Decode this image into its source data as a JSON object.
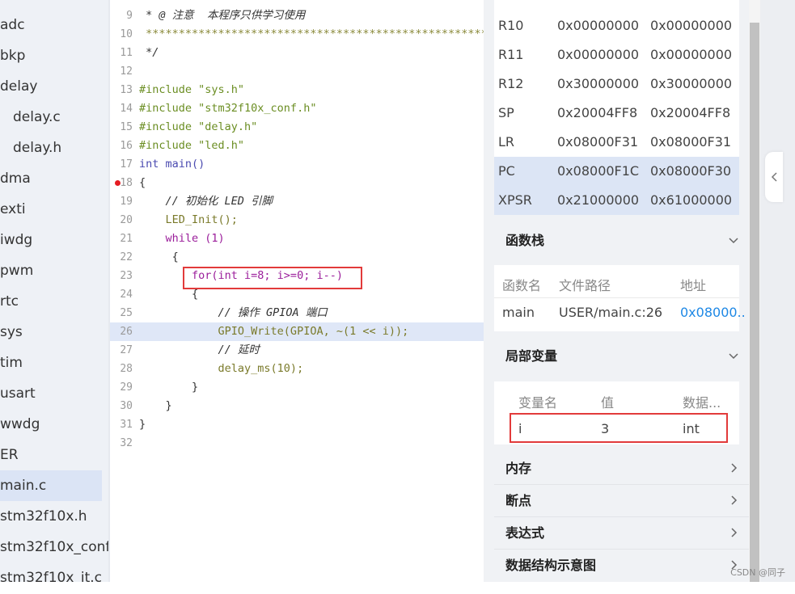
{
  "file_tree": [
    {
      "label": "adc"
    },
    {
      "label": "bkp"
    },
    {
      "label": "delay"
    },
    {
      "label": "delay.c"
    },
    {
      "label": "delay.h"
    },
    {
      "label": "dma"
    },
    {
      "label": "exti"
    },
    {
      "label": "iwdg"
    },
    {
      "label": "pwm"
    },
    {
      "label": "rtc"
    },
    {
      "label": "sys"
    },
    {
      "label": "tim"
    },
    {
      "label": "usart"
    },
    {
      "label": "wwdg"
    },
    {
      "label": "ER"
    },
    {
      "label": "main.c"
    },
    {
      "label": "stm32f10x.h"
    },
    {
      "label": "stm32f10x_conf.h"
    },
    {
      "label": "stm32f10x_it.c"
    }
  ],
  "editor": {
    "line_numbers": [
      "9",
      "10",
      "11",
      "12",
      "13",
      "14",
      "15",
      "16",
      "17",
      "18",
      "19",
      "20",
      "21",
      "22",
      "23",
      "24",
      "25",
      "26",
      "27",
      "28",
      "29",
      "30",
      "31",
      "32"
    ],
    "lines": [
      " * @ 注意  本程序只供学习使用",
      " ******************************************************",
      " */",
      "",
      "#include \"sys.h\"",
      "#include \"stm32f10x_conf.h\"",
      "#include \"delay.h\"",
      "#include \"led.h\"",
      "int main()",
      "{",
      "    // 初始化 LED 引脚",
      "    LED_Init();",
      "    while (1)",
      "     {",
      "        for(int i=8; i>=0; i--)",
      "        {",
      "            // 操作 GPIOA 端口",
      "            GPIO_Write(GPIOA, ~(1 << i));",
      "            // 延时",
      "            delay_ms(10);",
      "        }",
      "    }",
      "}",
      ""
    ]
  },
  "registers": [
    {
      "name": "R10",
      "value": "0x00000000",
      "prev": "0x00000000"
    },
    {
      "name": "R11",
      "value": "0x00000000",
      "prev": "0x00000000"
    },
    {
      "name": "R12",
      "value": "0x30000000",
      "prev": "0x30000000"
    },
    {
      "name": "SP",
      "value": "0x20004FF8",
      "prev": "0x20004FF8"
    },
    {
      "name": "LR",
      "value": "0x08000F31",
      "prev": "0x08000F31"
    },
    {
      "name": "PC",
      "value": "0x08000F1C",
      "prev": "0x08000F30"
    },
    {
      "name": "XPSR",
      "value": "0x21000000",
      "prev": "0x61000000"
    }
  ],
  "call_stack": {
    "title": "函数栈",
    "headers": [
      "函数名",
      "文件路径",
      "地址"
    ],
    "rows": [
      {
        "func": "main",
        "path": "USER/main.c:26",
        "addr": "0x08000.."
      }
    ]
  },
  "locals": {
    "title": "局部变量",
    "headers": [
      "变量名",
      "值",
      "数据..."
    ],
    "rows": [
      {
        "name": "i",
        "value": "3",
        "type": "int"
      }
    ]
  },
  "sections": {
    "memory": "内存",
    "breakpoints": "断点",
    "expressions": "表达式",
    "data_structure": "数据结构示意图"
  },
  "icons": {
    "expand": "chevron-down-icon",
    "collapse": "chevron-right-icon",
    "side_collapse": "chevron-left-icon"
  },
  "colors": {
    "highlight": "#dfe7f7",
    "breakpoint": "#e51c23",
    "red_box": "#e23b3b",
    "link": "#1e88e5"
  },
  "watermark": "CSDN @同子"
}
